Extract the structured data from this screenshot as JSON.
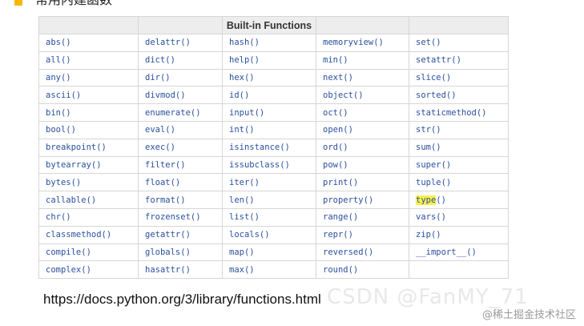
{
  "heading": "常用内建函数",
  "table": {
    "title": "Built-in Functions",
    "rows": [
      [
        "abs()",
        "delattr()",
        "hash()",
        "memoryview()",
        "set()"
      ],
      [
        "all()",
        "dict()",
        "help()",
        "min()",
        "setattr()"
      ],
      [
        "any()",
        "dir()",
        "hex()",
        "next()",
        "slice()"
      ],
      [
        "ascii()",
        "divmod()",
        "id()",
        "object()",
        "sorted()"
      ],
      [
        "bin()",
        "enumerate()",
        "input()",
        "oct()",
        "staticmethod()"
      ],
      [
        "bool()",
        "eval()",
        "int()",
        "open()",
        "str()"
      ],
      [
        "breakpoint()",
        "exec()",
        "isinstance()",
        "ord()",
        "sum()"
      ],
      [
        "bytearray()",
        "filter()",
        "issubclass()",
        "pow()",
        "super()"
      ],
      [
        "bytes()",
        "float()",
        "iter()",
        "print()",
        "tuple()"
      ],
      [
        "callable()",
        "format()",
        "len()",
        "property()",
        "type()"
      ],
      [
        "chr()",
        "frozenset()",
        "list()",
        "range()",
        "vars()"
      ],
      [
        "classmethod()",
        "getattr()",
        "locals()",
        "repr()",
        "zip()"
      ],
      [
        "compile()",
        "globals()",
        "map()",
        "reversed()",
        "__import__()"
      ],
      [
        "complex()",
        "hasattr()",
        "max()",
        "round()",
        ""
      ]
    ],
    "highlight": {
      "row": 9,
      "col": 4,
      "text": "type",
      "suffix": "()"
    }
  },
  "url": "https://docs.python.org/3/library/functions.html",
  "watermark_left": "CSDN @FanMY_71",
  "watermark_right": "@稀土掘金技术社区",
  "colors": {
    "link": "#2a4f9f",
    "highlight": "#fff04d",
    "bullet": "#f5b800"
  }
}
